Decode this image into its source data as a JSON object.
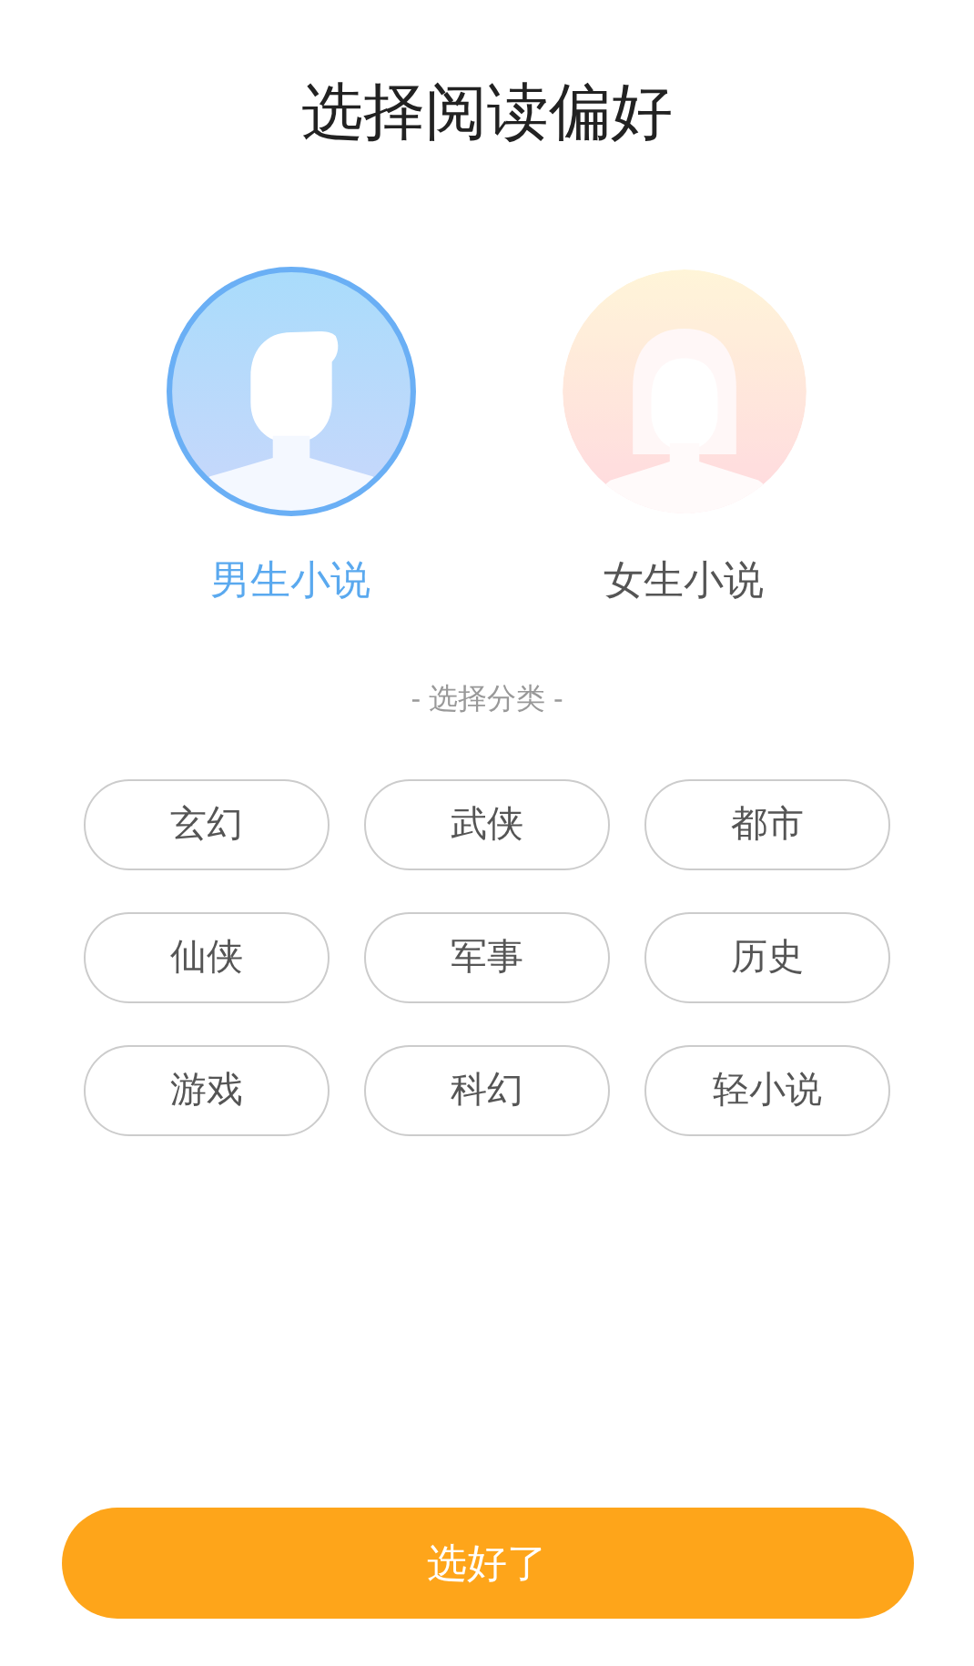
{
  "title": "选择阅读偏好",
  "genders": [
    {
      "kind": "male",
      "label": "男生小说",
      "selected": true
    },
    {
      "kind": "female",
      "label": "女生小说",
      "selected": false
    }
  ],
  "category_heading": "- 选择分类 -",
  "categories": [
    {
      "label": "玄幻",
      "selected": false
    },
    {
      "label": "武侠",
      "selected": false
    },
    {
      "label": "都市",
      "selected": false
    },
    {
      "label": "仙侠",
      "selected": false
    },
    {
      "label": "军事",
      "selected": false
    },
    {
      "label": "历史",
      "selected": false
    },
    {
      "label": "游戏",
      "selected": false
    },
    {
      "label": "科幻",
      "selected": false
    },
    {
      "label": "轻小说",
      "selected": false
    }
  ],
  "confirm_button": "选好了"
}
